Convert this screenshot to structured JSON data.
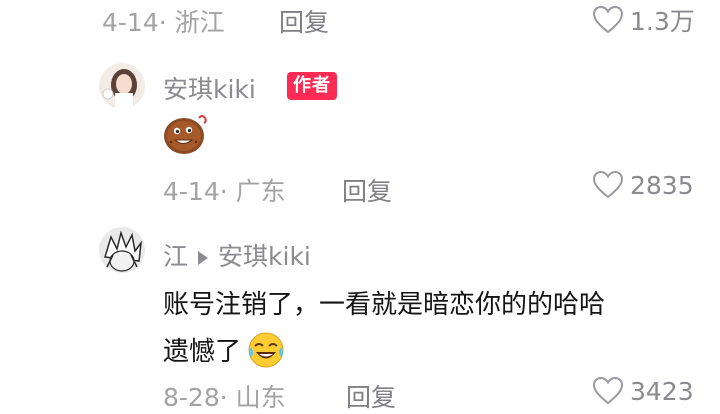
{
  "comment1": {
    "date_location": "4-14· 浙江",
    "reply_label": "回复",
    "likes": "1.3万"
  },
  "comment2": {
    "author": "安琪kiki",
    "badge": "作者",
    "emoji_icon": "cookie-emoji-icon",
    "date_location": "4-14· 广东",
    "reply_label": "回复",
    "likes": "2835"
  },
  "comment3": {
    "author": "江",
    "reply_to": "安琪kiki",
    "text_line1": "账号注销了，一看就是暗恋你的的哈哈",
    "text_line2": "遗憾了",
    "emoji_icon": "laughing-crying-emoji-icon",
    "date_location": "8-28· 山东",
    "reply_label": "回复",
    "likes": "3423"
  },
  "colors": {
    "badge": "#fe2c55",
    "meta_text": "#a3a3a6",
    "body_text": "#141414"
  }
}
